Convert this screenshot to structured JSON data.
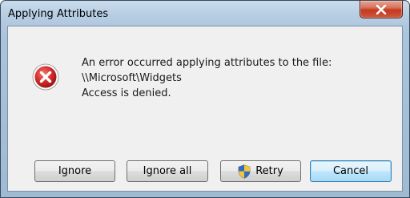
{
  "window": {
    "title": "Applying Attributes"
  },
  "message": {
    "line1": "An error occurred applying attributes to the file:",
    "line2": "\\\\Microsoft\\Widgets",
    "line3": "Access is denied."
  },
  "buttons": {
    "ignore": "Ignore",
    "ignore_all": "Ignore all",
    "retry": "Retry",
    "cancel": "Cancel"
  },
  "icons": {
    "close": "close-icon",
    "error": "error-icon",
    "shield": "shield-icon"
  },
  "colors": {
    "error_red": "#c4242b",
    "close_button": "#c23a1f",
    "default_button_border": "#3c7fb1"
  }
}
